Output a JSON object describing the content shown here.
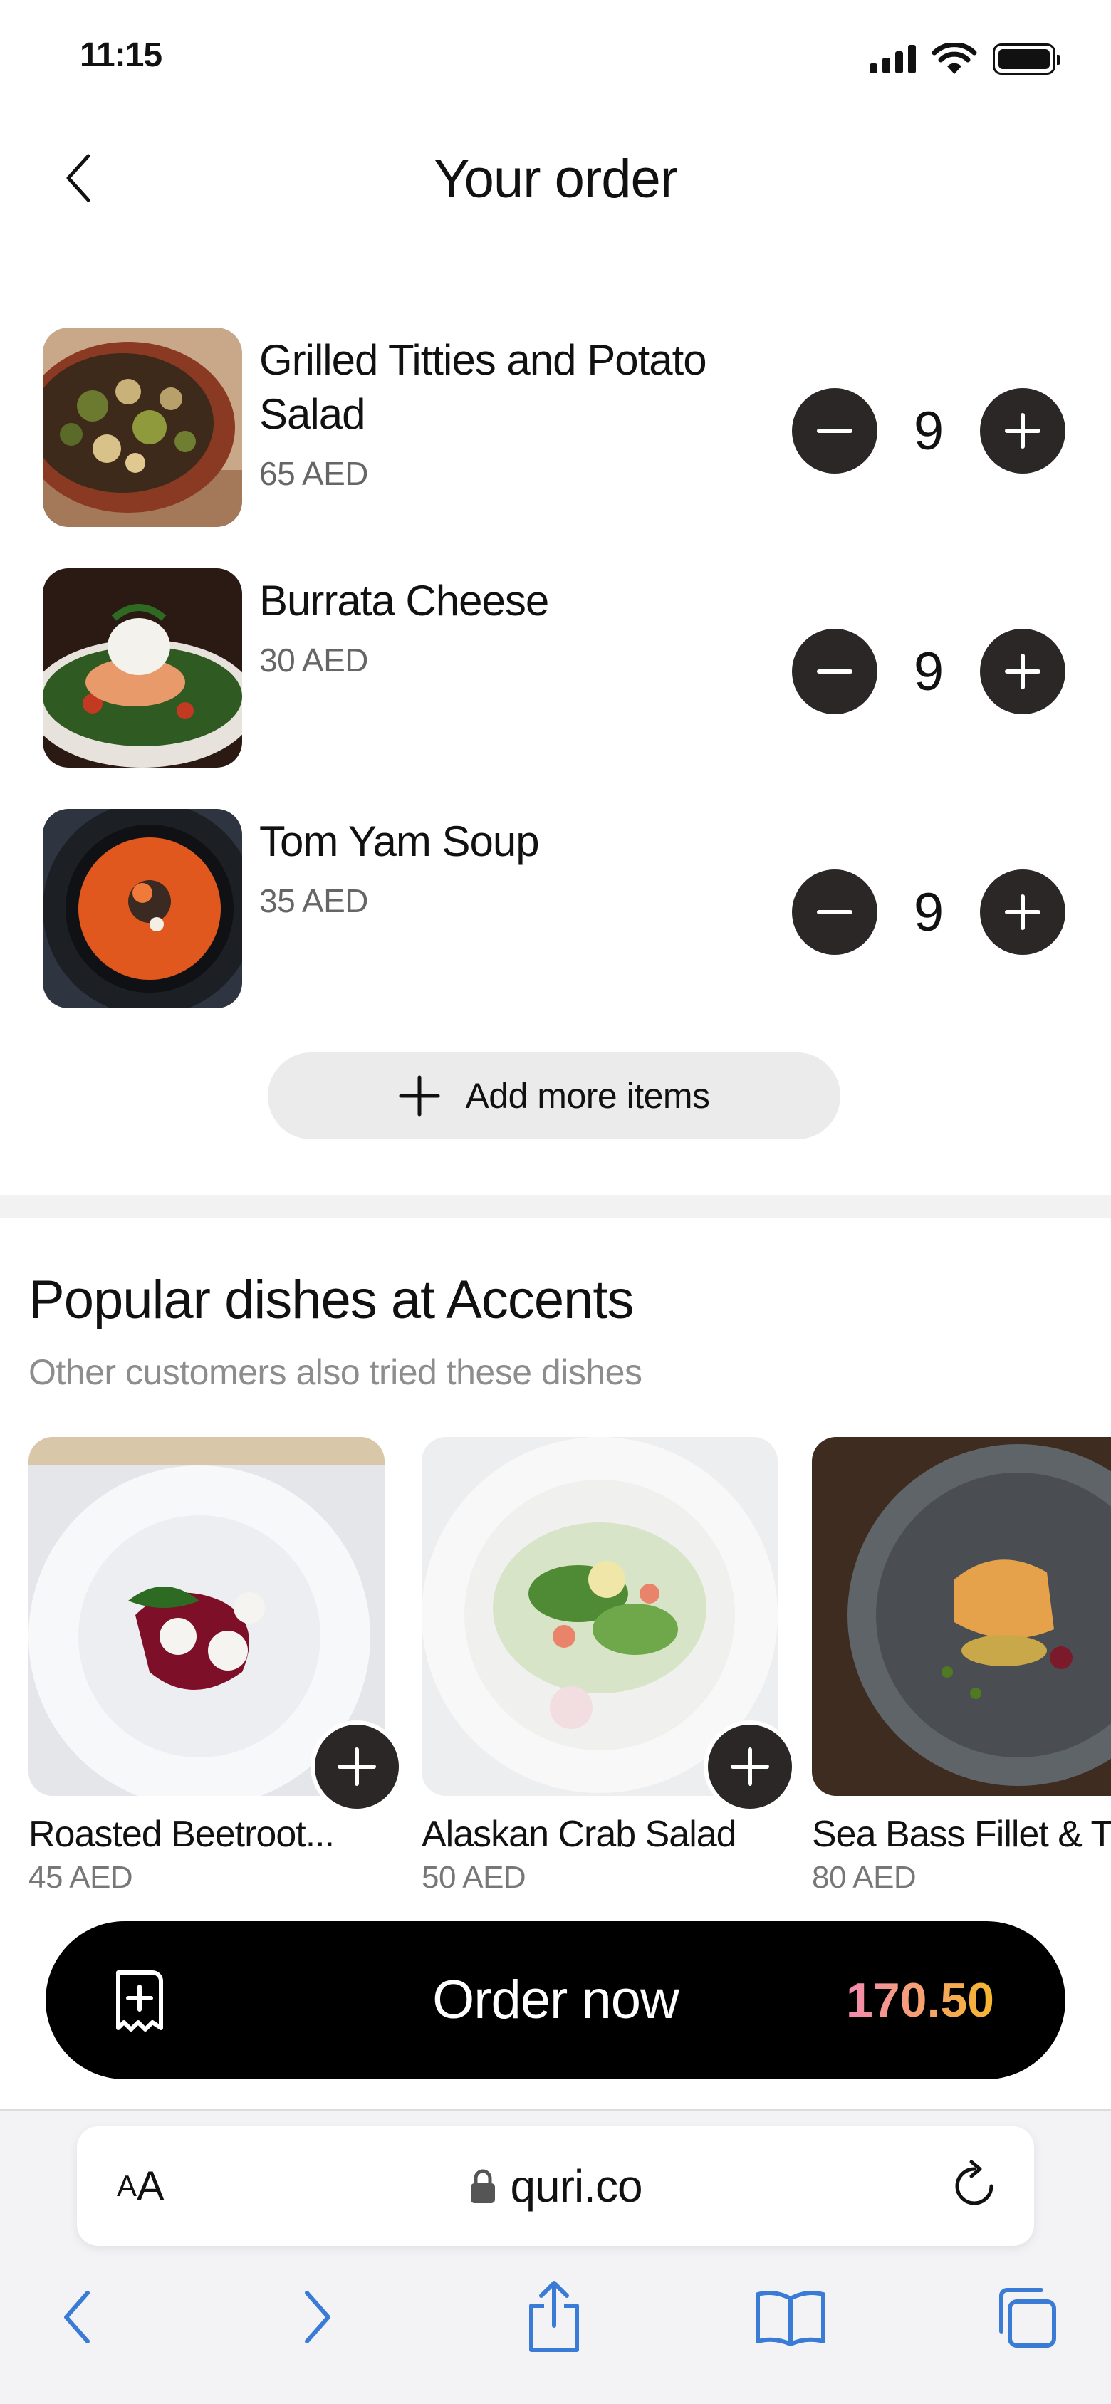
{
  "status_bar": {
    "time": "11:15"
  },
  "header": {
    "title": "Your order"
  },
  "order_items": [
    {
      "name": "Grilled Titties and Potato Salad",
      "price": "65 AED",
      "quantity": "9"
    },
    {
      "name": "Burrata Cheese",
      "price": "30 AED",
      "quantity": "9"
    },
    {
      "name": "Tom Yam Soup",
      "price": "35 AED",
      "quantity": "9"
    }
  ],
  "add_more": {
    "label": "Add more items"
  },
  "popular": {
    "title": "Popular dishes at Accents",
    "subtitle": "Other customers also tried these dishes",
    "dishes": [
      {
        "name": "Roasted Beetroot...",
        "price": "45 AED"
      },
      {
        "name": "Alaskan Crab Salad",
        "price": "50 AED"
      },
      {
        "name": "Sea Bass Fillet & T",
        "price": "80 AED"
      }
    ]
  },
  "order_bar": {
    "label": "Order now",
    "total": "170.50"
  },
  "browser": {
    "text_size_small": "A",
    "text_size_big": "A",
    "url": "quri.co"
  },
  "colors": {
    "accent_gradient_start": "#f48bb1",
    "accent_gradient_end": "#f7b62e",
    "ios_blue": "#3a7bd5",
    "dark_button": "#2a2726"
  }
}
